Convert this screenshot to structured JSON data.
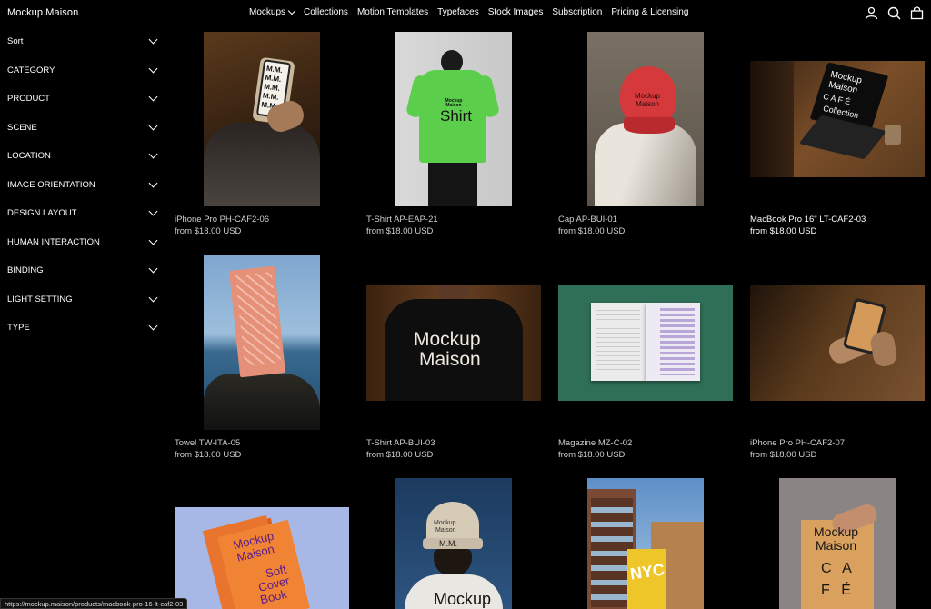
{
  "header": {
    "logo": "Mockup.Maison",
    "nav": [
      "Mockups",
      "Collections",
      "Motion Templates",
      "Typefaces",
      "Stock Images",
      "Subscription",
      "Pricing & Licensing"
    ]
  },
  "sidebar": {
    "filters": [
      "Sort",
      "CATEGORY",
      "PRODUCT",
      "SCENE",
      "LOCATION",
      "IMAGE ORIENTATION",
      "DESIGN LAYOUT",
      "HUMAN INTERACTION",
      "BINDING",
      "LIGHT SETTING",
      "TYPE"
    ]
  },
  "products": [
    {
      "title": "iPhone Pro PH-CAF2-06",
      "price": "from $18.00 USD"
    },
    {
      "title": "T-Shirt AP-EAP-21",
      "price": "from $18.00 USD"
    },
    {
      "title": "Cap AP-BUI-01",
      "price": "from $18.00 USD"
    },
    {
      "title": "MacBook Pro 16\" LT-CAF2-03",
      "price": "from $18.00 USD"
    },
    {
      "title": "Towel TW-ITA-05",
      "price": "from $18.00 USD"
    },
    {
      "title": "T-Shirt AP-BUI-03",
      "price": "from $18.00 USD"
    },
    {
      "title": "Magazine MZ-C-02",
      "price": "from $18.00 USD"
    },
    {
      "title": "iPhone Pro PH-CAF2-07",
      "price": "from $18.00 USD"
    }
  ],
  "image_text": {
    "phone1": "M.M.",
    "shirt_small": "Mockup Maison",
    "shirt_big": "Shirt",
    "cap": "Mockup Maison",
    "laptop": [
      "Mockup",
      "Maison",
      "C A F É",
      "Collection"
    ],
    "tshirt": [
      "Mockup",
      "Maison"
    ],
    "cap2": [
      "Mockup",
      "Maison",
      "M.M."
    ],
    "tshirt2": "Mockup",
    "book": [
      "Mockup",
      "Maison",
      "Soft",
      "Cover",
      "Book"
    ],
    "nyc": "NYC",
    "bag": [
      "Mockup",
      "Maison",
      "C A",
      "F É"
    ]
  },
  "status_bar": {
    "url": "https://mockup.maison/products/macbook-pro-16-lt-caf2-03"
  },
  "colors": {
    "background": "#000000",
    "text": "#ffffff",
    "caption": "#cfcfcf"
  }
}
